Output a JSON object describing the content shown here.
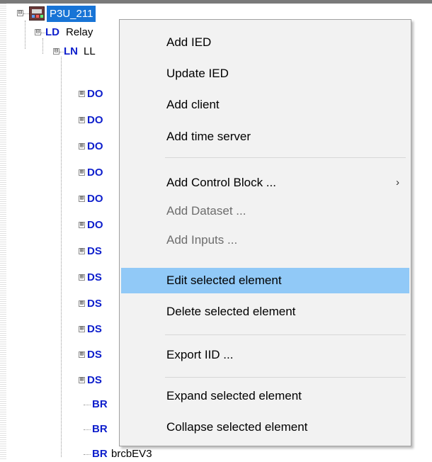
{
  "tree": {
    "root": {
      "expander": "⊟",
      "icon": "ied-device-icon",
      "label": "P3U_211"
    },
    "ld": {
      "expander": "⊟",
      "tag": "LD",
      "name": "Relay"
    },
    "ln": {
      "expander": "⊟",
      "tag": "LN",
      "name": "LL"
    },
    "children": [
      {
        "expander": "⊞",
        "tag": "DO",
        "name": ""
      },
      {
        "expander": "⊞",
        "tag": "DO",
        "name": ""
      },
      {
        "expander": "⊞",
        "tag": "DO",
        "name": ""
      },
      {
        "expander": "⊞",
        "tag": "DO",
        "name": ""
      },
      {
        "expander": "⊞",
        "tag": "DO",
        "name": ""
      },
      {
        "expander": "⊞",
        "tag": "DO",
        "name": ""
      },
      {
        "expander": "⊞",
        "tag": "DS",
        "name": ""
      },
      {
        "expander": "⊞",
        "tag": "DS",
        "name": ""
      },
      {
        "expander": "⊞",
        "tag": "DS",
        "name": ""
      },
      {
        "expander": "⊞",
        "tag": "DS",
        "name": ""
      },
      {
        "expander": "⊞",
        "tag": "DS",
        "name": ""
      },
      {
        "expander": "⊞",
        "tag": "DS",
        "name": ""
      },
      {
        "expander": "",
        "tag": "BR",
        "name": ""
      },
      {
        "expander": "",
        "tag": "BR",
        "name": ""
      },
      {
        "expander": "",
        "tag": "BR",
        "name": "brcbEV3"
      }
    ]
  },
  "menu": {
    "add_ied": "Add IED",
    "update_ied": "Update IED",
    "add_client": "Add client",
    "add_time_server": "Add time server",
    "add_control_block": "Add Control Block ...",
    "submenu_arrow": "›",
    "add_dataset": "Add Dataset ...",
    "add_inputs": "Add Inputs ...",
    "edit_selected": "Edit selected element",
    "delete_selected": "Delete selected element",
    "export_iid": "Export IID ...",
    "expand_selected": "Expand selected element",
    "collapse_selected": "Collapse selected element"
  },
  "colors": {
    "selection": "#1874d6",
    "tag_blue": "#0d1ecc",
    "menu_bg": "#f2f2f2",
    "menu_hover": "#91c9f7",
    "disabled_text": "#6d6d6d"
  }
}
